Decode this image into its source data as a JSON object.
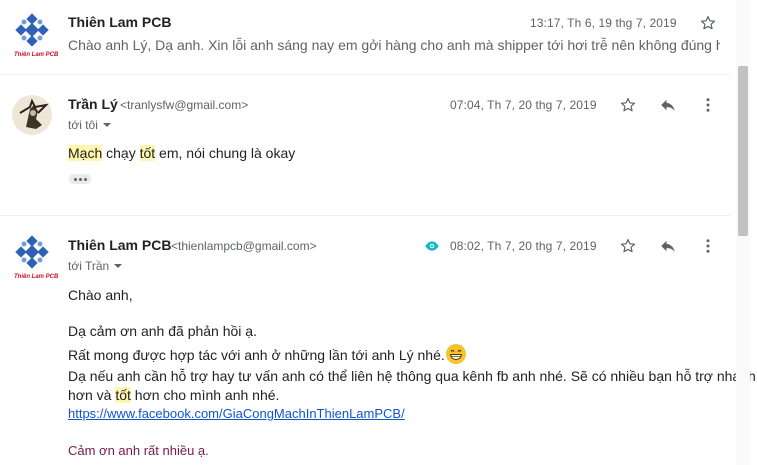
{
  "messages": [
    {
      "sender": "Thiên Lam PCB",
      "date": "13:17, Th 6, 19 thg 7, 2019",
      "snippet": "Chào anh Lý, Dạ anh. Xin lỗi anh sáng nay em gởi hàng cho anh mà shipper tới hơi trễ nên không đúng hẹ...",
      "logo_text": "Thiên Lam PCB"
    },
    {
      "sender": "Trần Lý",
      "email": "<tranlysfw@gmail.com>",
      "date": "07:04, Th 7, 20 thg 7, 2019",
      "to": "tới tôi",
      "body_parts": [
        "Mạch",
        " chạy ",
        "tốt",
        " em, nói chung là okay"
      ]
    },
    {
      "sender": "Thiên Lam PCB",
      "email": "<thienlampcb@gmail.com>",
      "date": "08:02, Th 7, 20 thg 7, 2019",
      "to": "tới Trần",
      "greeting": "Chào anh,",
      "line1": "Dạ cảm ơn anh đã phản hồi ạ.",
      "line2": "Rất mong được hợp tác với anh ở những lần tới anh Lý nhé.",
      "line3": "Dạ nếu anh cần hỗ trợ hay tư vấn anh có thể liên hệ thông qua kênh fb anh nhé. Sẽ có nhiều bạn hỗ trợ nhanh",
      "line4_a": "hơn và ",
      "line4_b": "tốt",
      "line4_c": " hơn cho mình anh nhé.",
      "link": "https://www.facebook.com/GiaCongMachInThienLamPCB/",
      "signoff": "Cảm ơn anh rất nhiều ạ.",
      "logo_text": "Thiên Lam PCB"
    }
  ],
  "icons": {
    "star": "star-icon",
    "reply": "reply-icon",
    "more": "more-vert-icon",
    "eye": "eye-icon",
    "expand": "ellipsis-icon",
    "dropdown": "caret-down-icon"
  },
  "colors": {
    "accent_eye": "#12b5cb",
    "link": "#1155cc",
    "highlight": "#fff7b0",
    "signoff": "#741b47"
  }
}
